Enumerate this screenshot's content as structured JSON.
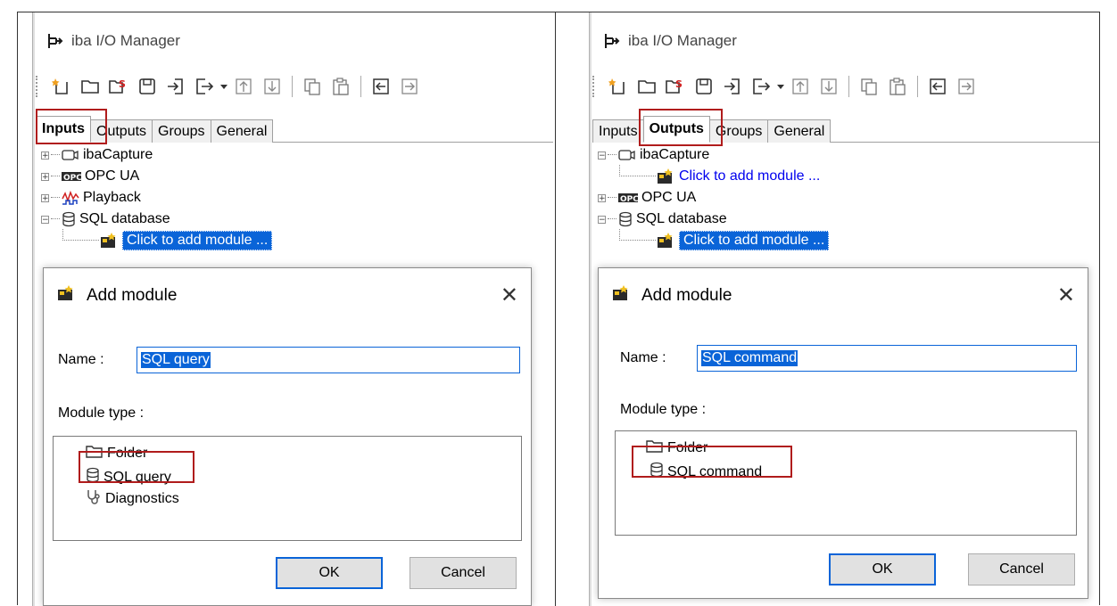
{
  "left": {
    "app_title": "iba I/O Manager",
    "tabs": [
      "Inputs",
      "Outputs",
      "Groups",
      "General"
    ],
    "active_tab": "Inputs",
    "tree": {
      "ibacapture": "ibaCapture",
      "opcua": "OPC UA",
      "playback": "Playback",
      "sql": "SQL database",
      "add": "Click to add module ..."
    },
    "dialog": {
      "title": "Add module",
      "close": "✕",
      "name_label": "Name :",
      "name_value": "SQL query",
      "module_type_label": "Module type :",
      "types": [
        "Folder",
        "SQL query",
        "Diagnostics"
      ],
      "ok": "OK",
      "cancel": "Cancel"
    }
  },
  "right": {
    "app_title": "iba I/O Manager",
    "tabs": [
      "Inputs",
      "Outputs",
      "Groups",
      "General"
    ],
    "active_tab": "Outputs",
    "tree": {
      "ibacapture": "ibaCapture",
      "add1": "Click to add module ...",
      "opcua": "OPC UA",
      "sql": "SQL database",
      "add2": "Click to add module ..."
    },
    "dialog": {
      "title": "Add module",
      "close": "✕",
      "name_label": "Name :",
      "name_value": "SQL command",
      "module_type_label": "Module type :",
      "types": [
        "Folder",
        "SQL command"
      ],
      "ok": "OK",
      "cancel": "Cancel"
    }
  },
  "colors": {
    "highlight": "#b01c1c",
    "selection": "#0a64d8",
    "link": "#0000ee"
  }
}
